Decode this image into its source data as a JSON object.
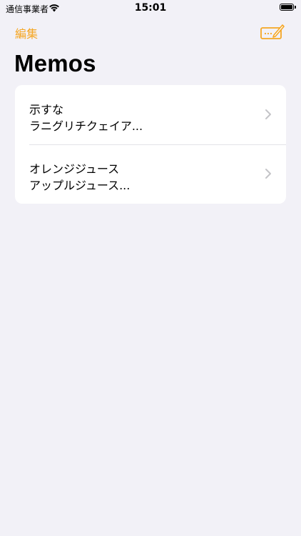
{
  "status_bar": {
    "carrier": "通信事業者",
    "time": "15:01"
  },
  "nav": {
    "edit_label": "編集",
    "compose_icon": "compose-icon"
  },
  "title": "Memos",
  "memos": [
    {
      "title": "示すな",
      "preview": "ラニグリチクェイア..."
    },
    {
      "title": "オレンジジュース",
      "preview": "アップルジュース..."
    }
  ],
  "colors": {
    "accent": "#f5a623",
    "background": "#f2f1f7",
    "card": "#ffffff",
    "chevron": "#c4c4c7"
  }
}
